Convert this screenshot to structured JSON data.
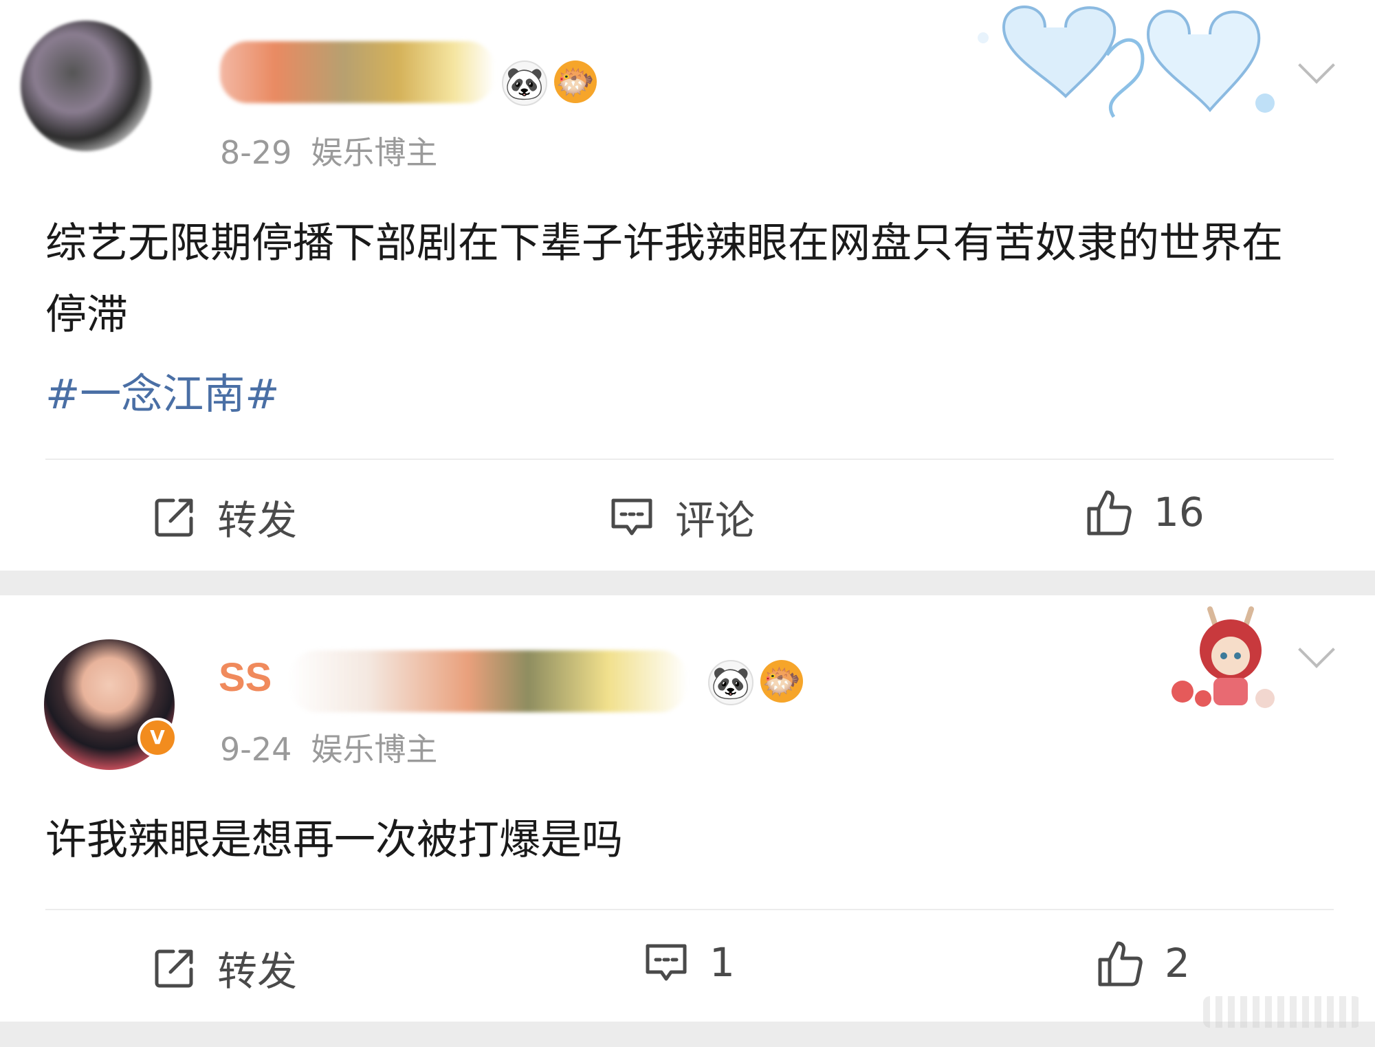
{
  "posts": [
    {
      "date": "8-29",
      "role": "娱乐博主",
      "text": "综艺无限期停播下部剧在下辈子许我辣眼在网盘只有苦奴隶的世界在停滞",
      "hashtag": "#一念江南#",
      "actions": {
        "repost": "转发",
        "comment": "评论",
        "like": "16"
      }
    },
    {
      "username_fragment": "SS",
      "verified_badge": "V",
      "date": "9-24",
      "role": "娱乐博主",
      "text": "许我辣眼是想再一次被打爆是吗",
      "actions": {
        "repost": "转发",
        "comment": "1",
        "like": "2"
      }
    }
  ],
  "icons": {
    "repost": "repost-icon",
    "comment": "comment-icon",
    "like": "thumbs-up-icon",
    "more": "chevron-down-icon"
  },
  "colors": {
    "hashtag": "#4a6fa5",
    "verified": "#f28c1e",
    "meta_text": "#9a9a9a"
  }
}
